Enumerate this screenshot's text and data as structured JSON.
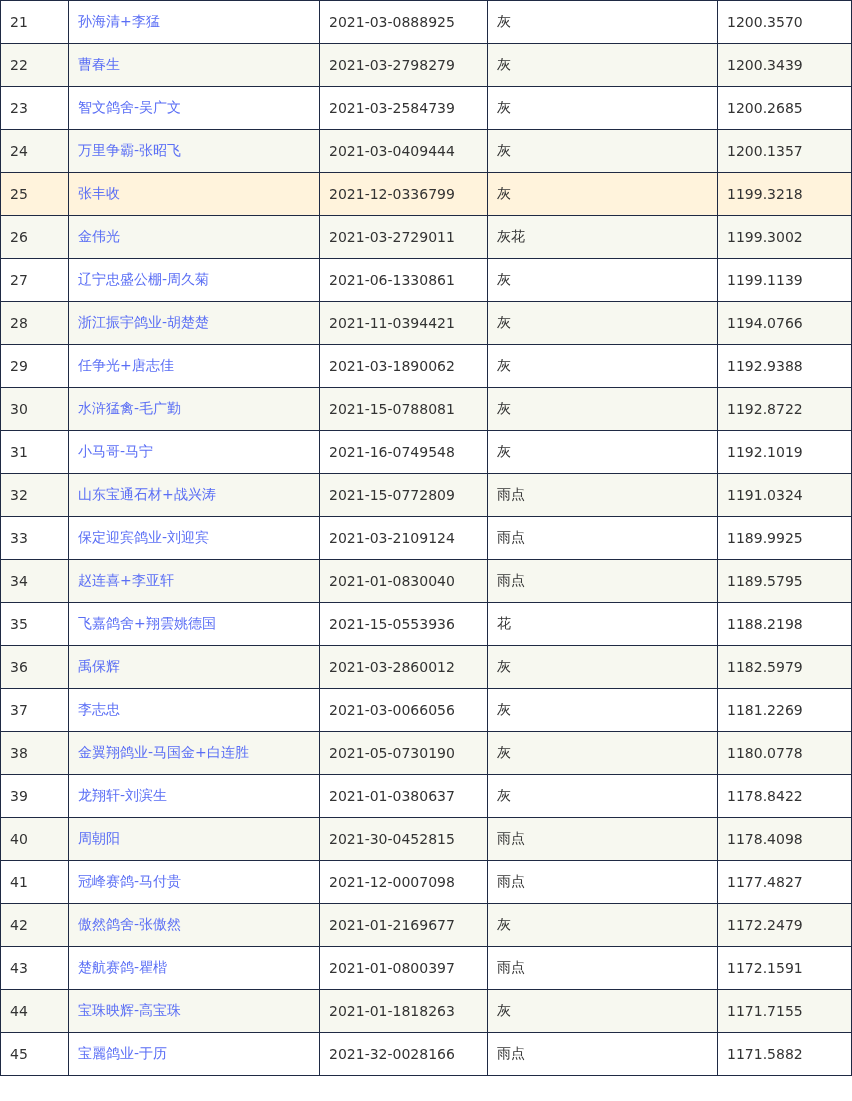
{
  "table": {
    "rows": [
      {
        "rank": "21",
        "name": "孙海清+李猛",
        "ring": "2021-03-0888925",
        "plumage": "灰",
        "score": "1200.3570",
        "selected": false
      },
      {
        "rank": "22",
        "name": "曹春生",
        "ring": "2021-03-2798279",
        "plumage": "灰",
        "score": "1200.3439",
        "selected": false
      },
      {
        "rank": "23",
        "name": "智文鸽舍-吴广文",
        "ring": "2021-03-2584739",
        "plumage": "灰",
        "score": "1200.2685",
        "selected": false
      },
      {
        "rank": "24",
        "name": "万里争霸-张昭飞",
        "ring": "2021-03-0409444",
        "plumage": "灰",
        "score": "1200.1357",
        "selected": false
      },
      {
        "rank": "25",
        "name": "张丰收",
        "ring": "2021-12-0336799",
        "plumage": "灰",
        "score": "1199.3218",
        "selected": true
      },
      {
        "rank": "26",
        "name": "金伟光",
        "ring": "2021-03-2729011",
        "plumage": "灰花",
        "score": "1199.3002",
        "selected": false
      },
      {
        "rank": "27",
        "name": "辽宁忠盛公棚-周久菊",
        "ring": "2021-06-1330861",
        "plumage": "灰",
        "score": "1199.1139",
        "selected": false
      },
      {
        "rank": "28",
        "name": "浙江振宇鸽业-胡楚楚",
        "ring": "2021-11-0394421",
        "plumage": "灰",
        "score": "1194.0766",
        "selected": false
      },
      {
        "rank": "29",
        "name": "任争光+唐志佳",
        "ring": "2021-03-1890062",
        "plumage": "灰",
        "score": "1192.9388",
        "selected": false
      },
      {
        "rank": "30",
        "name": "水浒猛禽-毛广勤",
        "ring": "2021-15-0788081",
        "plumage": "灰",
        "score": "1192.8722",
        "selected": false
      },
      {
        "rank": "31",
        "name": "小马哥-马宁",
        "ring": "2021-16-0749548",
        "plumage": "灰",
        "score": "1192.1019",
        "selected": false
      },
      {
        "rank": "32",
        "name": "山东宝通石材+战兴涛",
        "ring": "2021-15-0772809",
        "plumage": "雨点",
        "score": "1191.0324",
        "selected": false
      },
      {
        "rank": "33",
        "name": "保定迎宾鸽业-刘迎宾",
        "ring": "2021-03-2109124",
        "plumage": "雨点",
        "score": "1189.9925",
        "selected": false
      },
      {
        "rank": "34",
        "name": "赵连喜+李亚轩",
        "ring": "2021-01-0830040",
        "plumage": "雨点",
        "score": "1189.5795",
        "selected": false
      },
      {
        "rank": "35",
        "name": "飞嘉鸽舍+翔雲姚德国",
        "ring": "2021-15-0553936",
        "plumage": "花",
        "score": "1188.2198",
        "selected": false
      },
      {
        "rank": "36",
        "name": "禹保辉",
        "ring": "2021-03-2860012",
        "plumage": "灰",
        "score": "1182.5979",
        "selected": false
      },
      {
        "rank": "37",
        "name": "李志忠",
        "ring": "2021-03-0066056",
        "plumage": "灰",
        "score": "1181.2269",
        "selected": false
      },
      {
        "rank": "38",
        "name": "金翼翔鸽业-马国金+白连胜",
        "ring": "2021-05-0730190",
        "plumage": "灰",
        "score": "1180.0778",
        "selected": false
      },
      {
        "rank": "39",
        "name": "龙翔轩-刘滨生",
        "ring": "2021-01-0380637",
        "plumage": "灰",
        "score": "1178.8422",
        "selected": false
      },
      {
        "rank": "40",
        "name": "周朝阳",
        "ring": "2021-30-0452815",
        "plumage": "雨点",
        "score": "1178.4098",
        "selected": false
      },
      {
        "rank": "41",
        "name": "冠峰赛鸽-马付贵",
        "ring": "2021-12-0007098",
        "plumage": "雨点",
        "score": "1177.4827",
        "selected": false
      },
      {
        "rank": "42",
        "name": "傲然鸽舍-张傲然",
        "ring": "2021-01-2169677",
        "plumage": "灰",
        "score": "1172.2479",
        "selected": false
      },
      {
        "rank": "43",
        "name": "楚航赛鸽-瞿楷",
        "ring": "2021-01-0800397",
        "plumage": "雨点",
        "score": "1172.1591",
        "selected": false
      },
      {
        "rank": "44",
        "name": "宝珠映辉-高宝珠",
        "ring": "2021-01-1818263",
        "plumage": "灰",
        "score": "1171.7155",
        "selected": false
      },
      {
        "rank": "45",
        "name": "宝麗鸽业-于历",
        "ring": "2021-32-0028166",
        "plumage": "雨点",
        "score": "1171.5882",
        "selected": false
      }
    ]
  }
}
